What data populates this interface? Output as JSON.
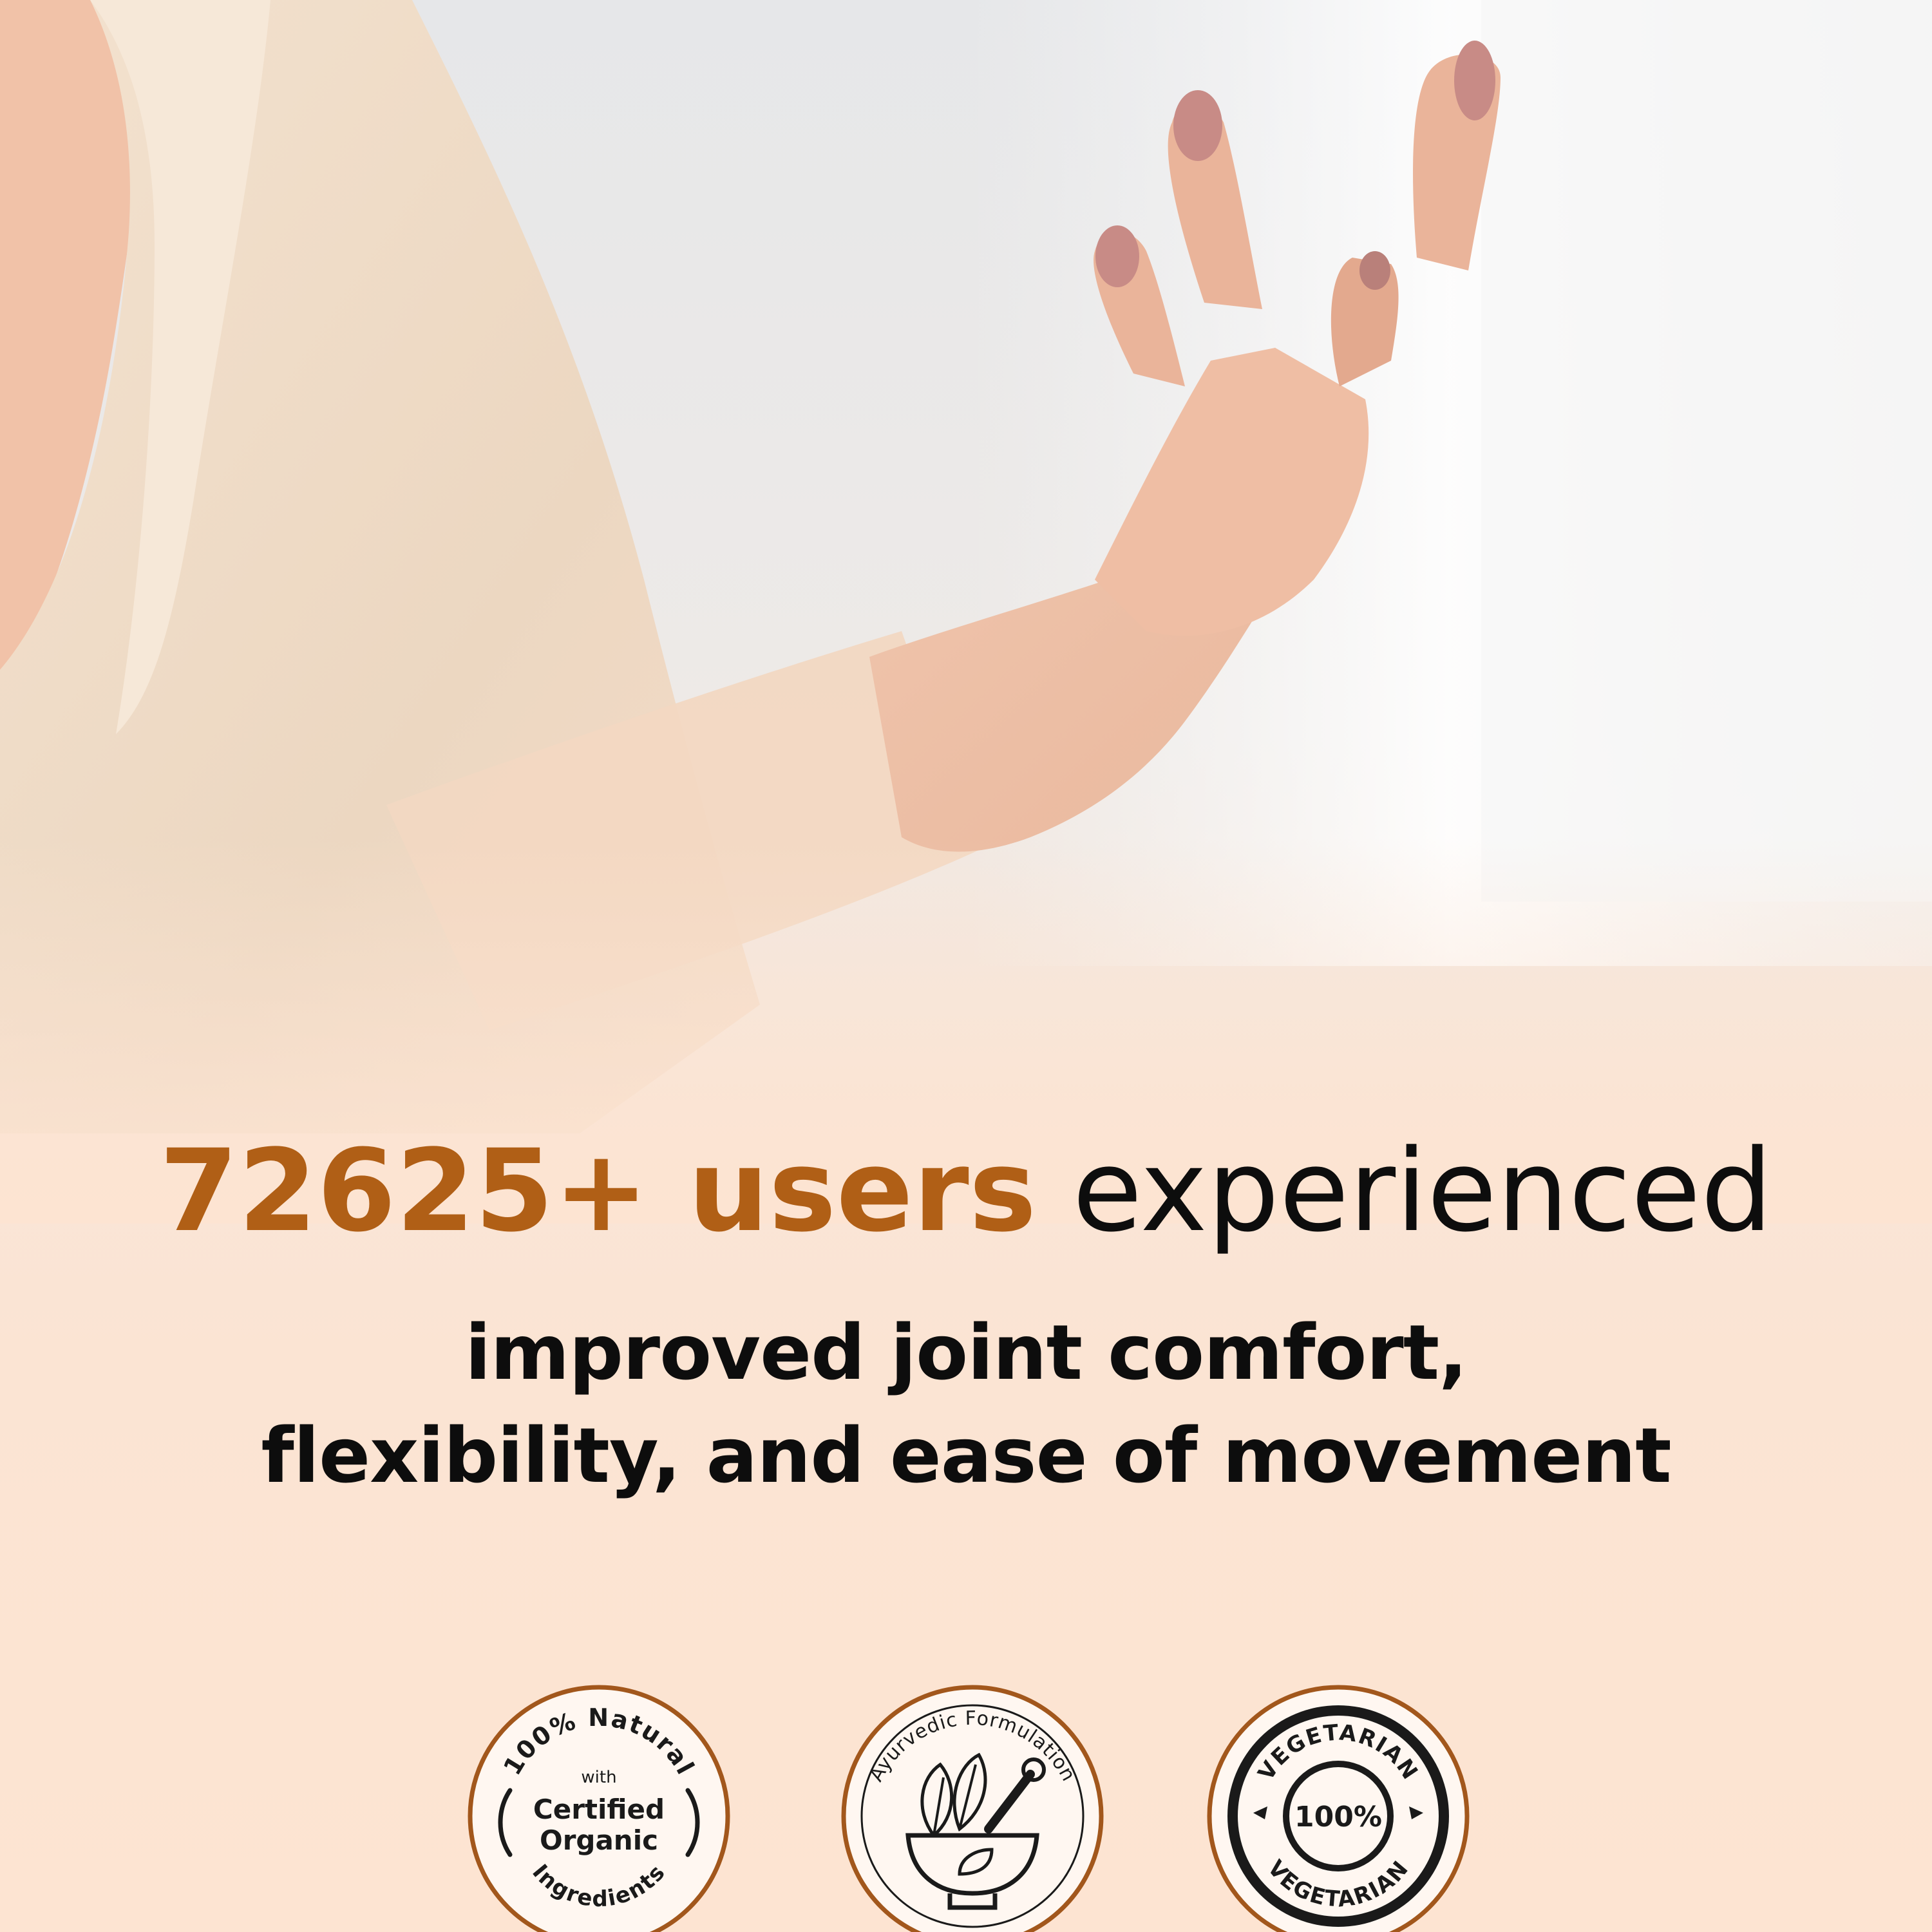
{
  "headline": {
    "accent": "72625+ users",
    "rest": "experienced"
  },
  "subheadline": {
    "line1": "improved joint comfort,",
    "line2": "flexibility, and ease of movement"
  },
  "badges": {
    "natural": {
      "arc_top": "100% Natural",
      "small": "with",
      "line1": "Certified",
      "line2": "Organic",
      "arc_bottom": "Ingredients",
      "icon": "organic-seal-icon"
    },
    "ayurvedic": {
      "arc_top": "Ayurvedic Formulation",
      "icon": "mortar-pestle-herbs-icon"
    },
    "vegetarian": {
      "arc_top": "VEGETARIAN",
      "center": "100%",
      "arc_bottom": "VEGETARIAN",
      "icon": "vegetarian-stamp-icon"
    }
  },
  "colors": {
    "accent": "#b05f16",
    "text": "#0d0d0d",
    "badge_ring": "#a2571c",
    "background": "#fde4d2"
  }
}
